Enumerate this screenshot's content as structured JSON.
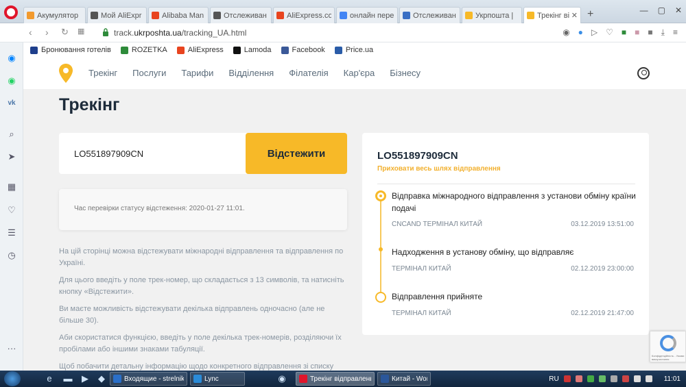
{
  "browser": {
    "tabs": [
      {
        "label": "Акумулятор",
        "color": "#f29a2e"
      },
      {
        "label": "Мой AliExpr",
        "color": "#555555"
      },
      {
        "label": "Alibaba Man",
        "color": "#e8441f"
      },
      {
        "label": "Отслеживан",
        "color": "#555555"
      },
      {
        "label": "AliExpress.co",
        "color": "#e8441f"
      },
      {
        "label": "онлайн пере",
        "color": "#4285f4"
      },
      {
        "label": "Отслеживан",
        "color": "#3a6fc4"
      },
      {
        "label": "Укрпошта |",
        "color": "#f7b928"
      },
      {
        "label": "Трекінг відп",
        "color": "#f7b928"
      }
    ],
    "url_prefix": "track.",
    "url_domain": "ukrposhta.ua",
    "url_path": "/tracking_UA.html"
  },
  "bookmarks": [
    {
      "label": "Бронювання готелів",
      "color": "#1e3f8c"
    },
    {
      "label": "ROZETKA",
      "color": "#2e8b3a"
    },
    {
      "label": "AliExpress",
      "color": "#e8441f"
    },
    {
      "label": "Lamoda",
      "color": "#111111"
    },
    {
      "label": "Facebook",
      "color": "#3b5998"
    },
    {
      "label": "Price.ua",
      "color": "#2a5ca8"
    }
  ],
  "site": {
    "nav": [
      "Трекінг",
      "Послуги",
      "Тарифи",
      "Відділення",
      "Філателія",
      "Кар'єра",
      "Бізнесу"
    ],
    "title": "Трекінг",
    "track_value": "LO551897909CN",
    "track_button": "Відстежити",
    "check_status": "Час перевірки статусу відстеження: 2020-01-27 11:01.",
    "info": [
      "На цій сторінці можна відстежувати міжнародні відправлення та відправлення по Україні.",
      "Для цього введіть у поле трек-номер, що складається з 13 символів, та натисніть кнопку «Відстежити».",
      "Ви маєте можливість відстежувати декілька відправлень одночасно (але не більше 30).",
      "Аби скористатися функцією, введіть у поле декілька трек-номерів, розділяючи їх пробілами або іншими знаками табуляції.",
      "Щоб побачити детальну інформацію щодо конкретного відправлення зі списку"
    ],
    "result": {
      "number": "LO551897909CN",
      "toggle": "Приховати весь шлях відправлення",
      "events": [
        {
          "title": "Відправка міжнародного відправлення з установи обміну країни подачі",
          "place": "CNCAND ТЕРМІНАЛ КИТАЙ",
          "date": "03.12.2019 13:51:00"
        },
        {
          "title": "Надходження в установу обміну, що відправляє",
          "place": "ТЕРМІНАЛ КИТАЙ",
          "date": "02.12.2019 23:00:00"
        },
        {
          "title": "Відправлення прийняте",
          "place": "ТЕРМІНАЛ КИТАЙ",
          "date": "02.12.2019 21:47:00"
        }
      ]
    },
    "recaptcha": "Конфіденційність - Умови використання"
  },
  "taskbar": {
    "tasks": [
      {
        "label": "Входящие - strelniko...",
        "color": "#2a6fc9"
      },
      {
        "label": "Lync",
        "color": "#2a8bd8"
      },
      {
        "label": "Трекінг відправлень...",
        "color": "#e0152b"
      },
      {
        "label": "Китай - Word",
        "color": "#2b579a"
      }
    ],
    "lang": "RU",
    "time": "11:01"
  }
}
